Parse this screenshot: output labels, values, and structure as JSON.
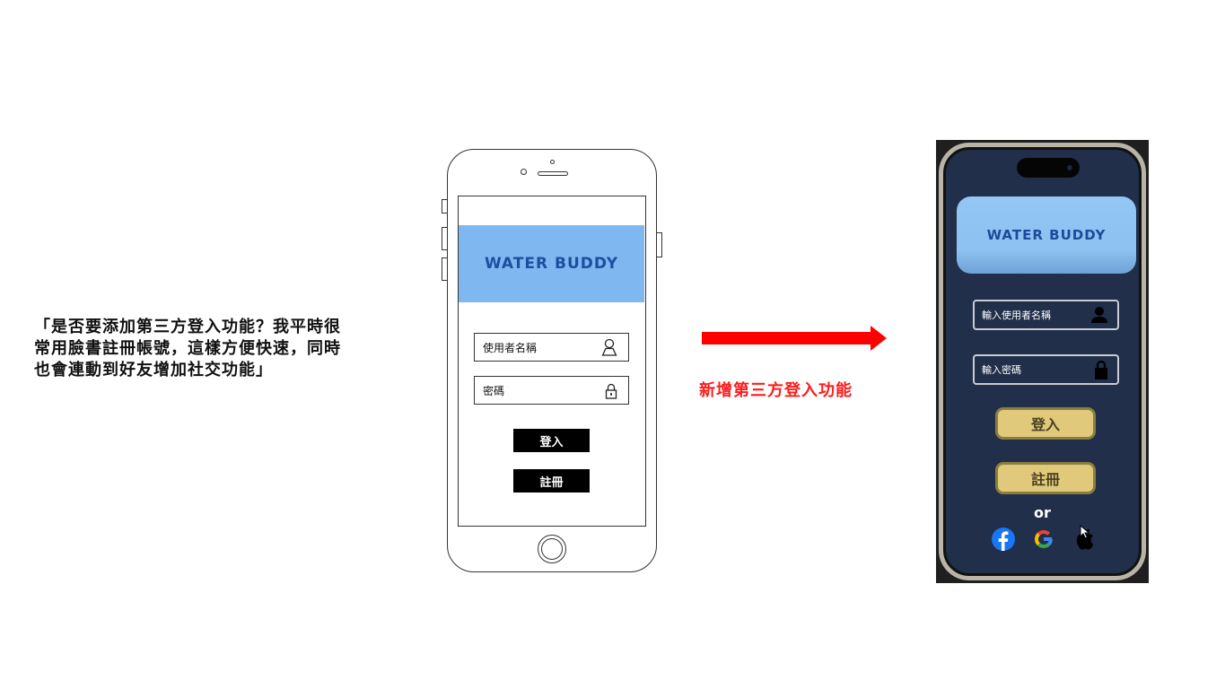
{
  "quote": {
    "lines": [
      "「是否要添加第三方登入功能？我平時很",
      "常用臉書註冊帳號，這樣方便快速，同時",
      "也會連動到好友增加社交功能」"
    ]
  },
  "wireframe": {
    "brand": "WATER BUDDY",
    "username_label": "使用者名稱",
    "password_label": "密碼",
    "login_button": "登入",
    "register_button": "註冊"
  },
  "arrow": {
    "label": "新增第三方登入功能",
    "color": "#ff0000"
  },
  "mockup": {
    "brand": "WATER BUDDY",
    "username_placeholder": "輸入使用者名稱",
    "password_placeholder": "輸入密碼",
    "login_button": "登入",
    "register_button": "註冊",
    "or_label": "or",
    "social_icons": [
      "facebook-icon",
      "google-icon",
      "apple-icon"
    ],
    "colors": {
      "background": "#212f4a",
      "banner": "#8dc1f1",
      "brand_text": "#1d4a9a",
      "button": "#e0c97a",
      "facebook": "#1877f2"
    }
  }
}
